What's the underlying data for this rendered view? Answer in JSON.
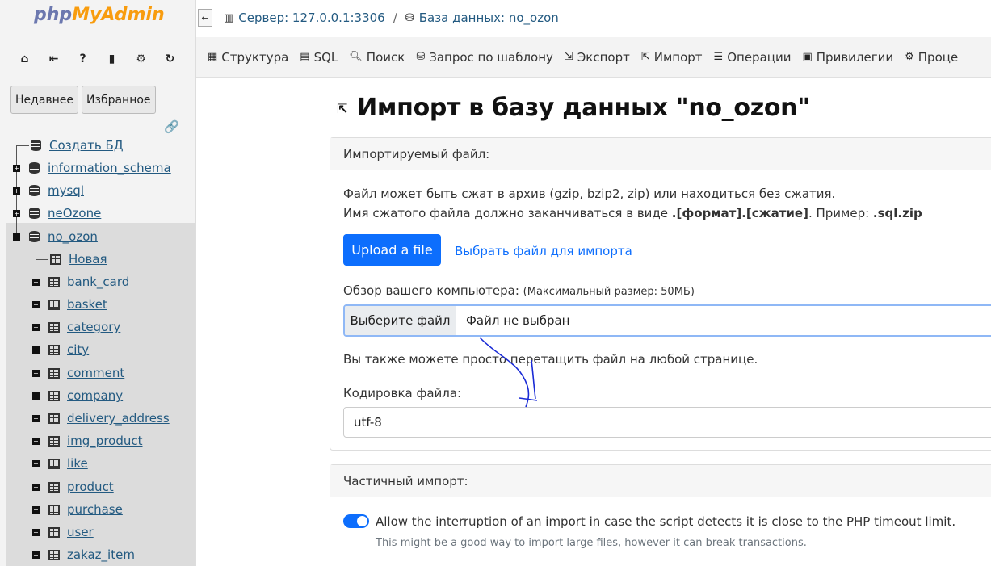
{
  "app": {
    "logo_php": "php",
    "logo_myadmin": "MyAdmin"
  },
  "nav": {
    "tabs": [
      "Недавнее",
      "Избранное"
    ],
    "icons": [
      "home-icon",
      "logout-icon",
      "help-icon",
      "docs-icon",
      "settings-icon",
      "reload-icon"
    ],
    "tree": [
      {
        "label": "Создать БД",
        "kind": "new"
      },
      {
        "label": "information_schema",
        "kind": "db"
      },
      {
        "label": "mysql",
        "kind": "db"
      },
      {
        "label": "neOzone",
        "kind": "db"
      },
      {
        "label": "no_ozon",
        "kind": "db",
        "selected": true
      }
    ],
    "tables": [
      "Новая",
      "bank_card",
      "basket",
      "category",
      "city",
      "comment",
      "company",
      "delivery_address",
      "img_product",
      "like",
      "product",
      "purchase",
      "user",
      "zakaz_item"
    ]
  },
  "breadcrumb": {
    "server": "Сервер: 127.0.0.1:3306",
    "sep": "»",
    "database": "База данных: no_ozon"
  },
  "menu": [
    {
      "label": "Структура",
      "icon": "structure-icon"
    },
    {
      "label": "SQL",
      "icon": "sql-icon"
    },
    {
      "label": "Поиск",
      "icon": "search-icon"
    },
    {
      "label": "Запрос по шаблону",
      "icon": "query-icon"
    },
    {
      "label": "Экспорт",
      "icon": "export-icon"
    },
    {
      "label": "Импорт",
      "icon": "import-icon"
    },
    {
      "label": "Операции",
      "icon": "operations-icon"
    },
    {
      "label": "Привилегии",
      "icon": "privileges-icon"
    },
    {
      "label": "Проце",
      "icon": "routines-icon"
    }
  ],
  "page": {
    "title": "Импорт в базу данных \"no_ozon\"",
    "file_card": {
      "header": "Импортируемый файл:",
      "line1": "Файл может быть сжат в архив (gzip, bzip2, zip) или находиться без сжатия.",
      "line2_pre": "Имя сжатого файла должно заканчиваться в виде ",
      "line2_bold1": ".[формат].[сжатие]",
      "line2_mid": ". Пример: ",
      "line2_bold2": ".sql.zip",
      "upload_button": "Upload a file",
      "choose_link": "Выбрать файл для импорта",
      "browse_label": "Обзор вашего компьютера:",
      "browse_limit": "(Максимальный размер: 50МБ)",
      "file_button": "Выберите файл",
      "file_status": "Файл не выбран",
      "drag_hint": "Вы также можете просто перетащить файл на любой странице.",
      "encoding_label": "Кодировка файла:",
      "encoding_value": "utf-8"
    },
    "partial_card": {
      "header": "Частичный импорт:",
      "allow_interrupt": "Allow the interruption of an import in case the script detects it is close to the PHP timeout limit.",
      "allow_hint": "This might be a good way to import large files, however it can break transactions.",
      "allow_checked": true
    }
  }
}
